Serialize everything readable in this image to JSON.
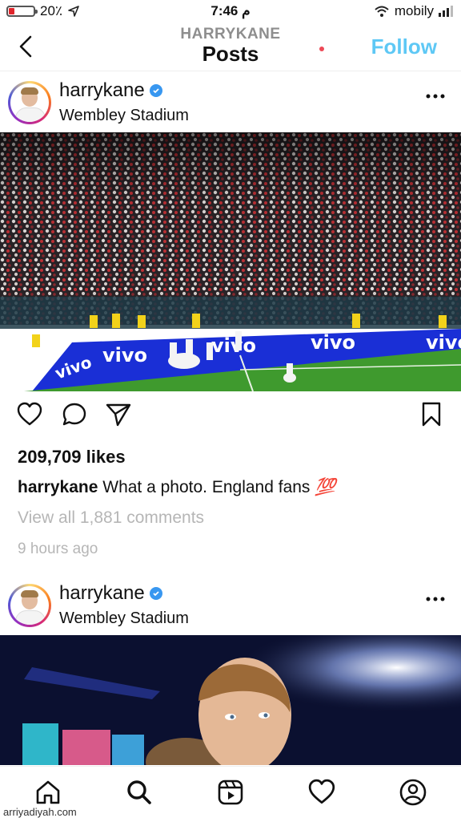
{
  "status_bar": {
    "battery": "20٪",
    "time": "7:46 م",
    "carrier": "mobily"
  },
  "header": {
    "username": "HARRYKANE",
    "title": "Posts",
    "follow_label": "Follow"
  },
  "posts": [
    {
      "username": "harrykane",
      "location": "Wembley Stadium",
      "banner_text": "vivo",
      "likes": "209,709 likes",
      "caption_user": "harrykane",
      "caption_text": "What a photo. England fans",
      "caption_emoji": "💯",
      "comments_link": "View all 1,881 comments",
      "time_ago": "9 hours ago"
    },
    {
      "username": "harrykane",
      "location": "Wembley Stadium"
    }
  ],
  "watermark": "arriyadiyah.com",
  "colors": {
    "follow": "#5ec8f5",
    "verified": "#3897f0",
    "notification_dot": "#ed4956",
    "pitch": "#3f9a2e",
    "banner": "#1a2fd6"
  },
  "icons": [
    "back-arrow-icon",
    "more-options-icon",
    "verified-badge-icon",
    "heart-icon",
    "comment-icon",
    "share-icon",
    "bookmark-icon",
    "home-icon",
    "search-icon",
    "reels-icon",
    "activity-heart-icon",
    "profile-icon"
  ]
}
